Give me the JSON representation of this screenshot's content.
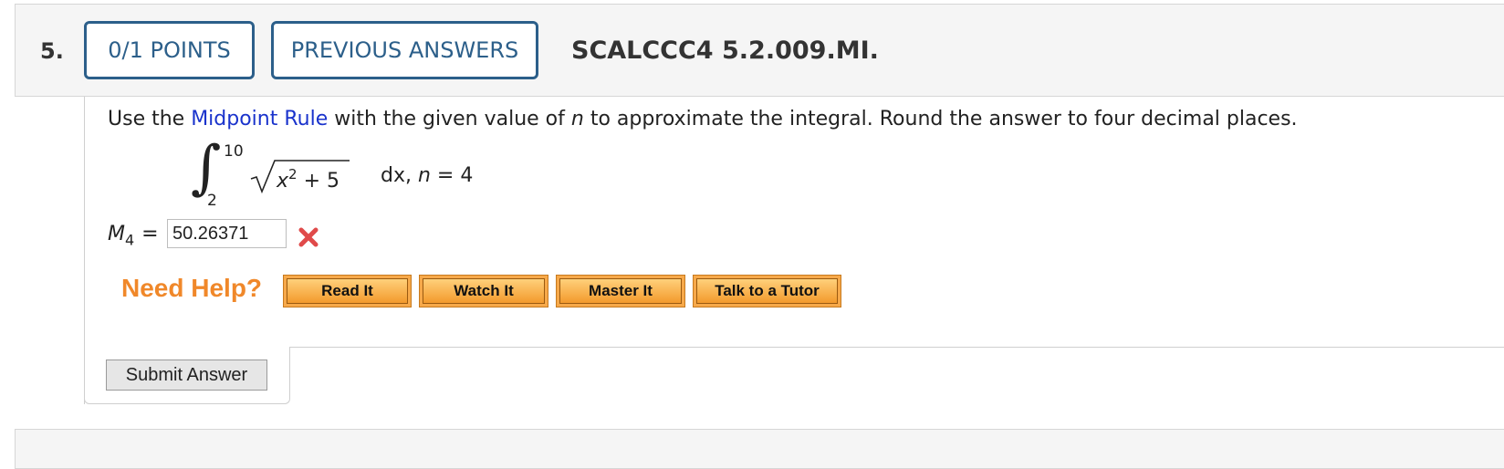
{
  "question": {
    "number": "5.",
    "points_label": "0/1 POINTS",
    "previous_label": "PREVIOUS ANSWERS",
    "id": "SCALCCC4 5.2.009.MI."
  },
  "prompt": {
    "part1": "Use the ",
    "link": "Midpoint Rule",
    "part2": " with the given value of ",
    "var": "n",
    "part3": " to approximate the integral. Round the answer to four decimal places."
  },
  "integral": {
    "upper": "10",
    "lower": "2",
    "radicand_base": "x",
    "radicand_exp": "2",
    "radicand_rest": " + 5",
    "dx": "dx, ",
    "nvar": "n",
    "nval": " = 4"
  },
  "answer": {
    "label": "M",
    "sub": "4",
    "equals": "=",
    "value": "50.26371",
    "status": "incorrect"
  },
  "help": {
    "label": "Need Help?",
    "buttons": [
      "Read It",
      "Watch It",
      "Master It",
      "Talk to a Tutor"
    ]
  },
  "submit_label": "Submit Answer",
  "colors": {
    "accent": "#2c5f8a",
    "link": "#1a33cc",
    "help": "#f0882a",
    "error": "#e04a4a"
  }
}
